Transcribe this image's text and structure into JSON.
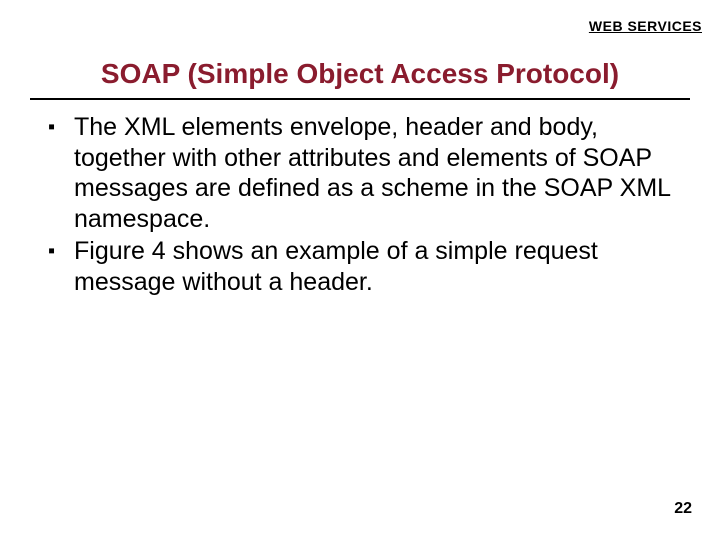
{
  "header": {
    "label": "WEB SERVICES"
  },
  "title": "SOAP (Simple Object Access Protocol)",
  "bullets": [
    "The XML elements envelope, header and body, together with other attributes and elements of SOAP messages are defined as a scheme in the SOAP XML namespace.",
    "Figure 4 shows an example of a simple request message without a header."
  ],
  "page_number": "22"
}
